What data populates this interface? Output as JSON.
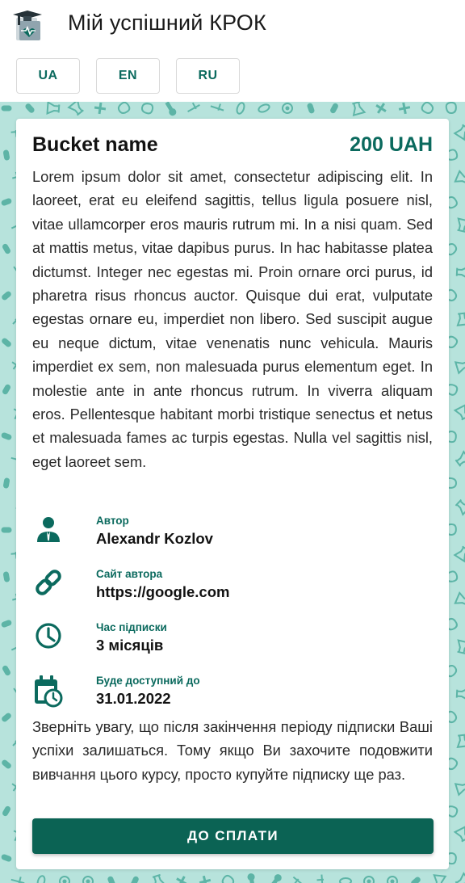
{
  "app": {
    "title": "Мій успішний КРОК",
    "languages": [
      {
        "label": "UA"
      },
      {
        "label": "EN"
      },
      {
        "label": "RU"
      }
    ]
  },
  "card": {
    "title": "Bucket name",
    "price": "200 UAH",
    "description": "Lorem ipsum dolor sit amet, consectetur adipiscing elit. In laoreet, erat eu eleifend sagittis, tellus ligula posuere nisl, vitae ullamcorper eros mauris rutrum mi. In a nisi quam. Sed at mattis metus, vitae dapibus purus. In hac habitasse platea dictumst. Integer nec egestas mi. Proin ornare orci purus, id pharetra risus rhoncus auctor. Quisque dui erat, vulputate egestas ornare eu, imperdiet non libero. Sed suscipit augue eu neque dictum, vitae venenatis nunc vehicula. Mauris imperdiet ex sem, non malesuada purus elementum eget. In molestie ante in ante rhoncus rutrum. In viverra aliquam eros. Pellentesque habitant morbi tristique senectus et netus et malesuada fames ac turpis egestas. Nulla vel sagittis nisl, eget laoreet sem.",
    "info": [
      {
        "icon": "author-icon",
        "label": "Автор",
        "value": "Alexandr Kozlov"
      },
      {
        "icon": "link-icon",
        "label": "Сайт автора",
        "value": "https://google.com"
      },
      {
        "icon": "clock-icon",
        "label": "Час підписки",
        "value": "3 місяців"
      },
      {
        "icon": "calendar-clock-icon",
        "label": "Буде доступний до",
        "value": "31.01.2022"
      }
    ],
    "notice": "Зверніть увагу, що після закінчення періоду підписки Ваші успіхи залишаться. Тому якщо Ви захочите подовжити вивчання цього курсу, просто купуйте підписку ще раз.",
    "pay_label": "ДО СПЛАТИ"
  },
  "colors": {
    "accent": "#0b6a5e",
    "button": "#0b6354",
    "pattern_bg": "#b7e3dc",
    "pattern_icon": "#3fa595"
  }
}
